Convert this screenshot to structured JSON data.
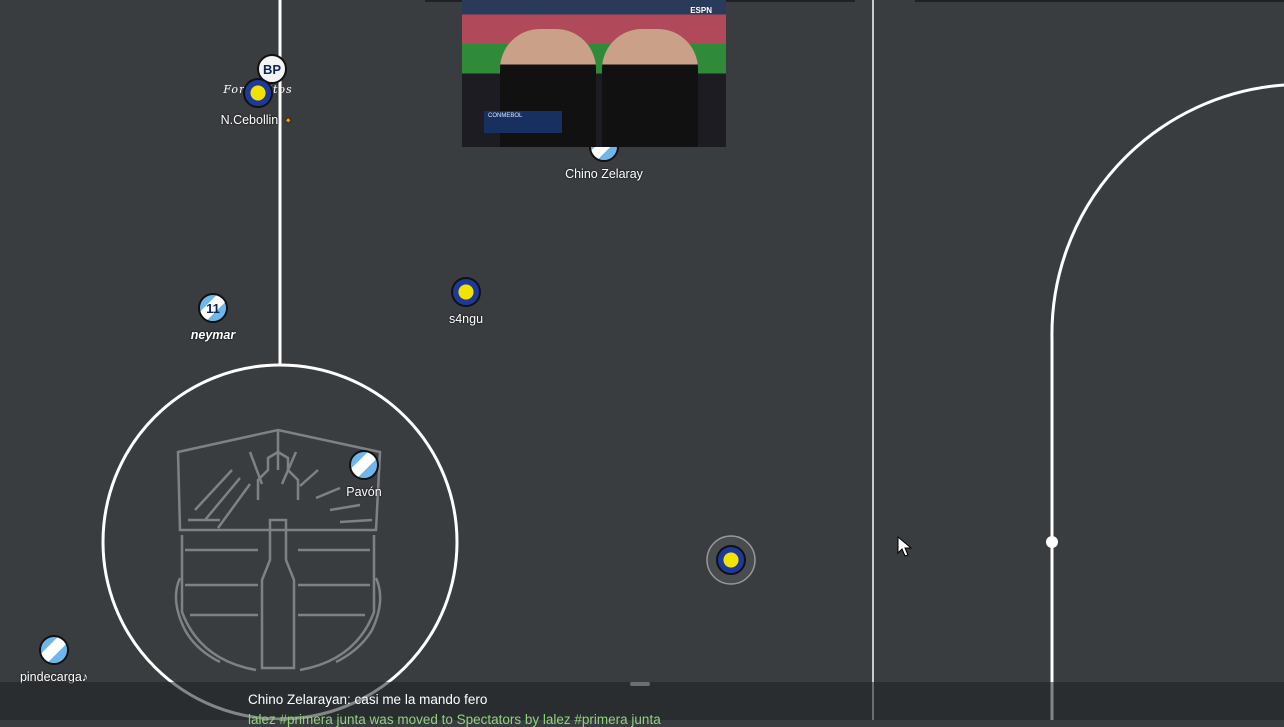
{
  "players": [
    {
      "id": "cebollin",
      "nick": "N.Cebollin",
      "kit": "boca",
      "avatar": "",
      "extra": "🔸",
      "italic": false
    },
    {
      "id": "bp",
      "nick": "",
      "kit": "white",
      "avatar": "BP",
      "italic": false
    },
    {
      "id": "chino",
      "nick": "Chino Zelaray",
      "kit": "arg",
      "avatar": "",
      "italic": false
    },
    {
      "id": "neymar",
      "nick": "neymar",
      "kit": "arg",
      "avatar": "11",
      "italic": true
    },
    {
      "id": "s4ngu",
      "nick": "s4ngu",
      "kit": "boca",
      "avatar": "",
      "italic": false
    },
    {
      "id": "pavon",
      "nick": "Pavón",
      "kit": "arg",
      "avatar": "",
      "italic": false
    },
    {
      "id": "pindecarga",
      "nick": "pindecarga♪",
      "kit": "arg",
      "avatar": "",
      "italic": false
    }
  ],
  "ball": {
    "kit": "boca"
  },
  "team_tag": "Foraneitos",
  "broadcast": {
    "channel": "ESPN",
    "lower_third": "CONMEBOL"
  },
  "chat": {
    "message": "Chino Zelarayan: casi me la mando fero",
    "system": "lalez #primera junta was moved to Spectators by lalez #primera junta"
  },
  "colors": {
    "field": "#3a3d40",
    "lines": "#ffffff",
    "team_light_blue": "#6fb7ea",
    "team_yellow": "#f2e300",
    "team_blue": "#1d3a9a",
    "chat_system": "#8fd47c"
  }
}
